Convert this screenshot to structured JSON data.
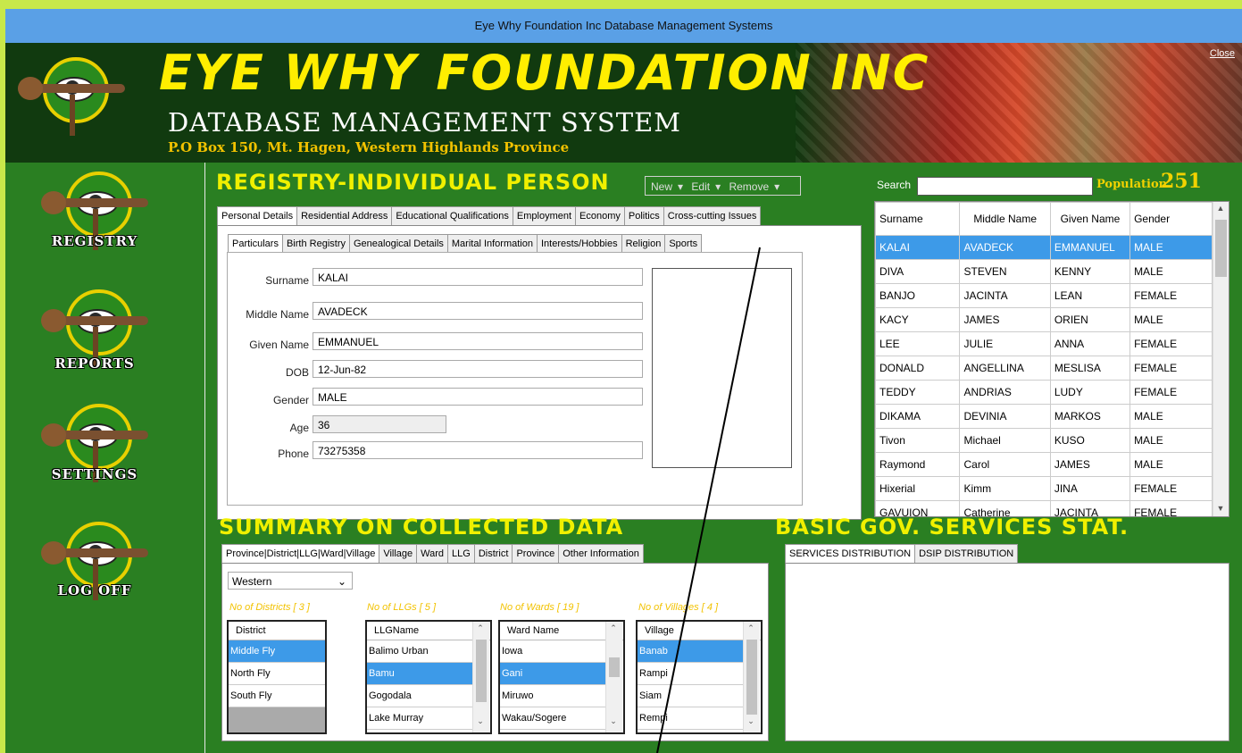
{
  "window": {
    "title": "Eye Why Foundation Inc Database Management Systems",
    "close_label": "Close"
  },
  "banner": {
    "title": "EYE WHY FOUNDATION INC",
    "subtitle": "DATABASE MANAGEMENT SYSTEM",
    "address": "P.O Box 150,  Mt. Hagen, Western Highlands Province",
    "logo_text": "EYE WHY FOUNDATION"
  },
  "sidebar": {
    "items": [
      {
        "label": "REGISTRY",
        "icon": "foundation-logo-icon"
      },
      {
        "label": "REPORTS",
        "icon": "foundation-logo-icon"
      },
      {
        "label": "SETTINGS",
        "icon": "foundation-logo-icon"
      },
      {
        "label": "LOG OFF",
        "icon": "foundation-logo-icon"
      }
    ]
  },
  "registry": {
    "heading": "REGISTRY-INDIVIDUAL PERSON",
    "menu": {
      "new": "New",
      "edit": "Edit",
      "remove": "Remove"
    },
    "main_tabs": [
      "Personal Details",
      "Residential Address",
      "Educational Qualifications",
      "Employment",
      "Economy",
      "Politics",
      "Cross-cutting Issues"
    ],
    "sub_tabs": [
      "Particulars",
      "Birth Registry",
      "Genealogical Details",
      "Marital Information",
      "Interests/Hobbies",
      "Religion",
      "Sports"
    ],
    "fields": {
      "surname": {
        "label": "Surname",
        "value": "KALAI"
      },
      "middle_name": {
        "label": "Middle Name",
        "value": "AVADECK"
      },
      "given_name": {
        "label": "Given Name",
        "value": "EMMANUEL"
      },
      "dob": {
        "label": "DOB",
        "value": "12-Jun-82"
      },
      "gender": {
        "label": "Gender",
        "value": "MALE"
      },
      "age": {
        "label": "Age",
        "value": "36"
      },
      "phone": {
        "label": "Phone",
        "value": "73275358"
      }
    }
  },
  "people": {
    "search_label": "Search",
    "search_value": "",
    "population_label": "Population",
    "population_value": "251",
    "columns": [
      "Surname",
      "Middle Name",
      "Given Name",
      "Gender"
    ],
    "rows": [
      [
        "KALAI",
        "AVADECK",
        "EMMANUEL",
        "MALE"
      ],
      [
        "DIVA",
        "STEVEN",
        "KENNY",
        "MALE"
      ],
      [
        "BANJO",
        "JACINTA",
        "LEAN",
        "FEMALE"
      ],
      [
        "KACY",
        "JAMES",
        "ORIEN",
        "MALE"
      ],
      [
        "LEE",
        "JULIE",
        "ANNA",
        "FEMALE"
      ],
      [
        "DONALD",
        "ANGELLINA",
        "MESLISA",
        "FEMALE"
      ],
      [
        "TEDDY",
        "ANDRIAS",
        "LUDY",
        "FEMALE"
      ],
      [
        "DIKAMA",
        "DEVINIA",
        "MARKOS",
        "MALE"
      ],
      [
        "Tivon",
        "Michael",
        "KUSO",
        "MALE"
      ],
      [
        "Raymond",
        "Carol",
        "JAMES",
        "MALE"
      ],
      [
        "Hixerial",
        "Kimm",
        "JINA",
        "FEMALE"
      ],
      [
        "GAVUION",
        "Catherine",
        "JACINTA",
        "FEMALE"
      ]
    ],
    "selected_row": 0
  },
  "summary": {
    "heading": "SUMMARY ON COLLECTED DATA",
    "tabs": [
      "Province|District|LLG|Ward|Village",
      "Village",
      "Ward",
      "LLG",
      "District",
      "Province",
      "Other Information"
    ],
    "province_select": "Western",
    "districts": {
      "label": "No of Districts [ 3 ]",
      "header": "District",
      "items": [
        "Middle Fly",
        "North Fly",
        "South Fly"
      ],
      "selected": 0
    },
    "llgs": {
      "label": "No of LLGs [ 5 ]",
      "header": "LLGName",
      "items": [
        "Balimo Urban",
        "Bamu",
        "Gogodala",
        "Lake Murray"
      ],
      "selected": 1
    },
    "wards": {
      "label": "No of Wards [ 19 ]",
      "header": "Ward Name",
      "items": [
        "Iowa",
        "Gani",
        "Miruwo",
        "Wakau/Sogere"
      ],
      "selected": 1
    },
    "villages": {
      "label": "No of Villages [ 4 ]",
      "header": "Village",
      "items": [
        "Banab",
        "Rampi",
        "Siam",
        "Rempi"
      ],
      "selected": 0
    }
  },
  "services": {
    "heading": "BASIC GOV. SERVICES STAT.",
    "tabs": [
      "SERVICES DISTRIBUTION",
      "DSIP DISTRIBUTION"
    ]
  },
  "colors": {
    "frame_green": "#2a7f22",
    "heading_yellow": "#f0f000",
    "selection_blue": "#3d9ae8",
    "title_blue": "#5aa0e6"
  }
}
